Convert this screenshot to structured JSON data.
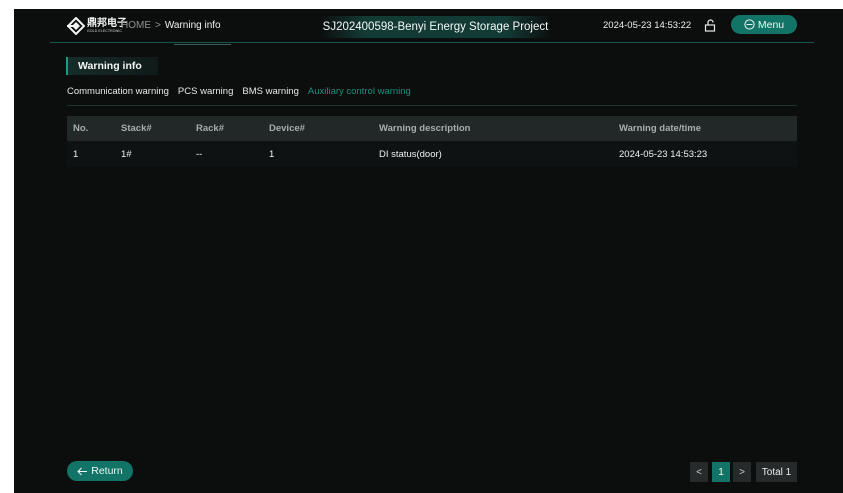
{
  "header": {
    "logo_cn": "鼎邦电子",
    "logo_en": "GOLD ELECTRONIC",
    "breadcrumb": {
      "home": "HOME",
      "separator": ">",
      "current": "Warning info"
    },
    "title": "SJ202400598-Benyi Energy Storage Project",
    "datetime": "2024-05-23 14:53:22",
    "lock_icon": "unlock-icon",
    "menu_label": "Menu",
    "menu_icon": "menu-circle-icon"
  },
  "section": {
    "label": "Warning info",
    "tabs": [
      {
        "label": "Communication warning",
        "active": false
      },
      {
        "label": "PCS warning",
        "active": false
      },
      {
        "label": "BMS warning",
        "active": false
      },
      {
        "label": "Auxiliary control warning",
        "active": true
      }
    ]
  },
  "table": {
    "columns": [
      "No.",
      "Stack#",
      "Rack#",
      "Device#",
      "Warning description",
      "Warning date/time"
    ],
    "rows": [
      [
        "1",
        "1#",
        "--",
        "1",
        "DI status(door)",
        "2024-05-23 14:53:23"
      ]
    ]
  },
  "footer": {
    "return_label": "Return",
    "return_icon": "arrow-left-icon",
    "pager": {
      "prev": "<",
      "current_page": "1",
      "next": ">",
      "total": "Total 1"
    }
  },
  "colors": {
    "accent": "#127466",
    "background": "#0c0d0d",
    "active_tab": "#1c8e7e",
    "header_row": "#222727"
  }
}
